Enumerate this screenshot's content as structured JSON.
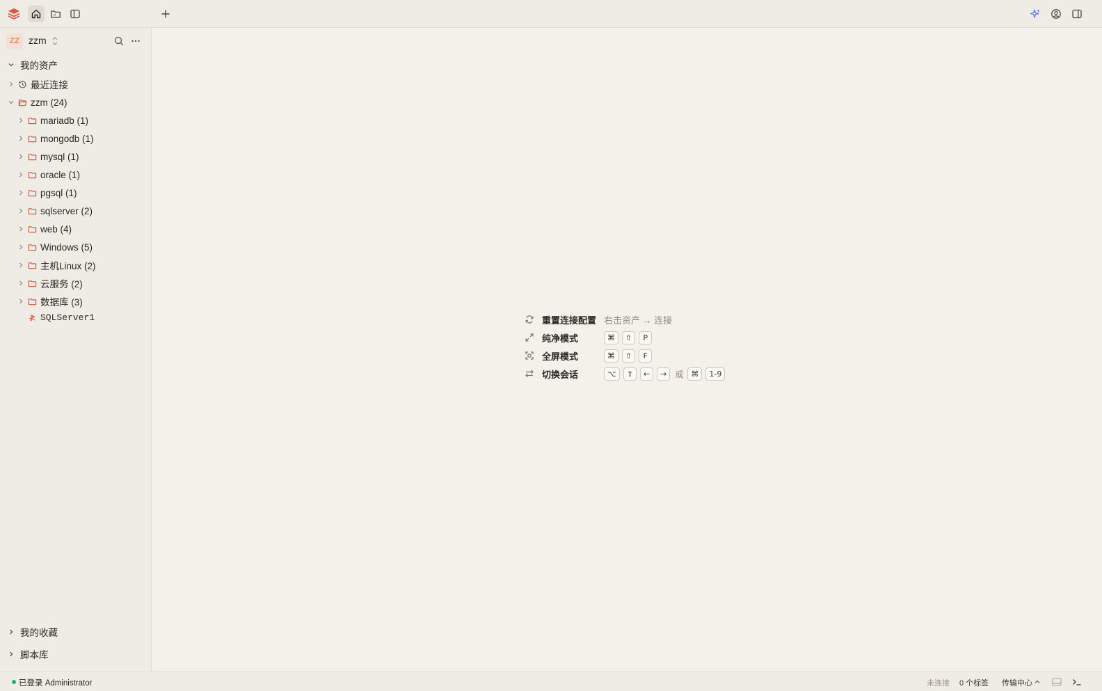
{
  "topbar": {
    "icons": [
      "app-logo-icon",
      "home-icon",
      "folder-icon",
      "sidebar-toggle-icon",
      "plus-icon",
      "ai-sparkle-icon",
      "user-circle-icon",
      "right-panel-icon"
    ]
  },
  "workspace": {
    "avatar": "ZZ",
    "name": "zzm"
  },
  "tree": {
    "root_label": "我的资产",
    "recent_label": "最近连接",
    "group_label": "zzm (24)",
    "folders": [
      {
        "label": "mariadb (1)"
      },
      {
        "label": "mongodb (1)"
      },
      {
        "label": "mysql (1)"
      },
      {
        "label": "oracle (1)"
      },
      {
        "label": "pgsql (1)"
      },
      {
        "label": "sqlserver (2)"
      },
      {
        "label": "web (4)"
      },
      {
        "label": "Windows (5)"
      },
      {
        "label": "主机Linux (2)"
      },
      {
        "label": "云服务 (2)"
      },
      {
        "label": "数据库 (3)"
      }
    ],
    "asset_label": "SQLServer1"
  },
  "sections": {
    "favorites": "我的收藏",
    "scripts": "脚本库"
  },
  "hints": [
    {
      "icon": "refresh-icon",
      "label": "重置连接配置",
      "text": "右击资产 → 连接"
    },
    {
      "icon": "expand-icon",
      "label": "纯净模式",
      "keys": [
        "⌘",
        "⇧",
        "P"
      ]
    },
    {
      "icon": "fullscreen-icon",
      "label": "全屏模式",
      "keys": [
        "⌘",
        "⇧",
        "F"
      ]
    },
    {
      "icon": "switch-icon",
      "label": "切换会话",
      "keys": [
        "⌥",
        "⇧",
        "←",
        "→"
      ],
      "or": "或",
      "keys2": [
        "⌘",
        "1-9"
      ]
    }
  ],
  "statusbar": {
    "login": "已登录 Administrator",
    "connection": "未连接",
    "tags": "0 个标签",
    "transfer": "传输中心"
  },
  "colors": {
    "accent": "#c5563f",
    "online": "#23b26b",
    "background": "#f4f1ea"
  }
}
